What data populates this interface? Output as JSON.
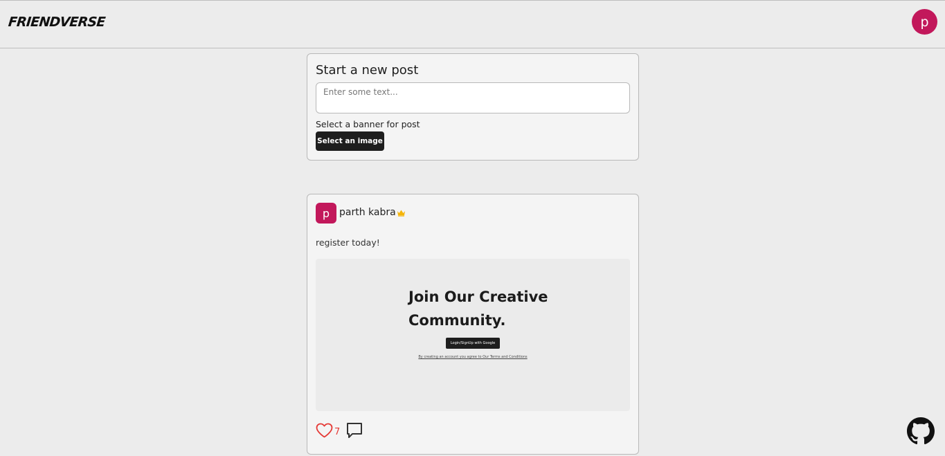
{
  "header": {
    "logo": "FRIENDVERSE",
    "user_initial": "p",
    "avatar_color": "#c2185b"
  },
  "composer": {
    "title": "Start a new post",
    "placeholder": "Enter some text...",
    "banner_label": "Select a banner for post",
    "select_button": "Select an image"
  },
  "post": {
    "author_initial": "p",
    "author_name": "parth kabra",
    "badge_icon": "crown-icon",
    "text": "register today!",
    "banner": {
      "heading_line1": "Join Our Creative",
      "heading_line2": "Community.",
      "button": "Login/SignUp with Google",
      "terms": "By creating an account you agree to Our Terms and Conditions"
    },
    "likes": "7",
    "like_color": "#e53935"
  },
  "footer": {
    "github_icon": "github-icon"
  }
}
